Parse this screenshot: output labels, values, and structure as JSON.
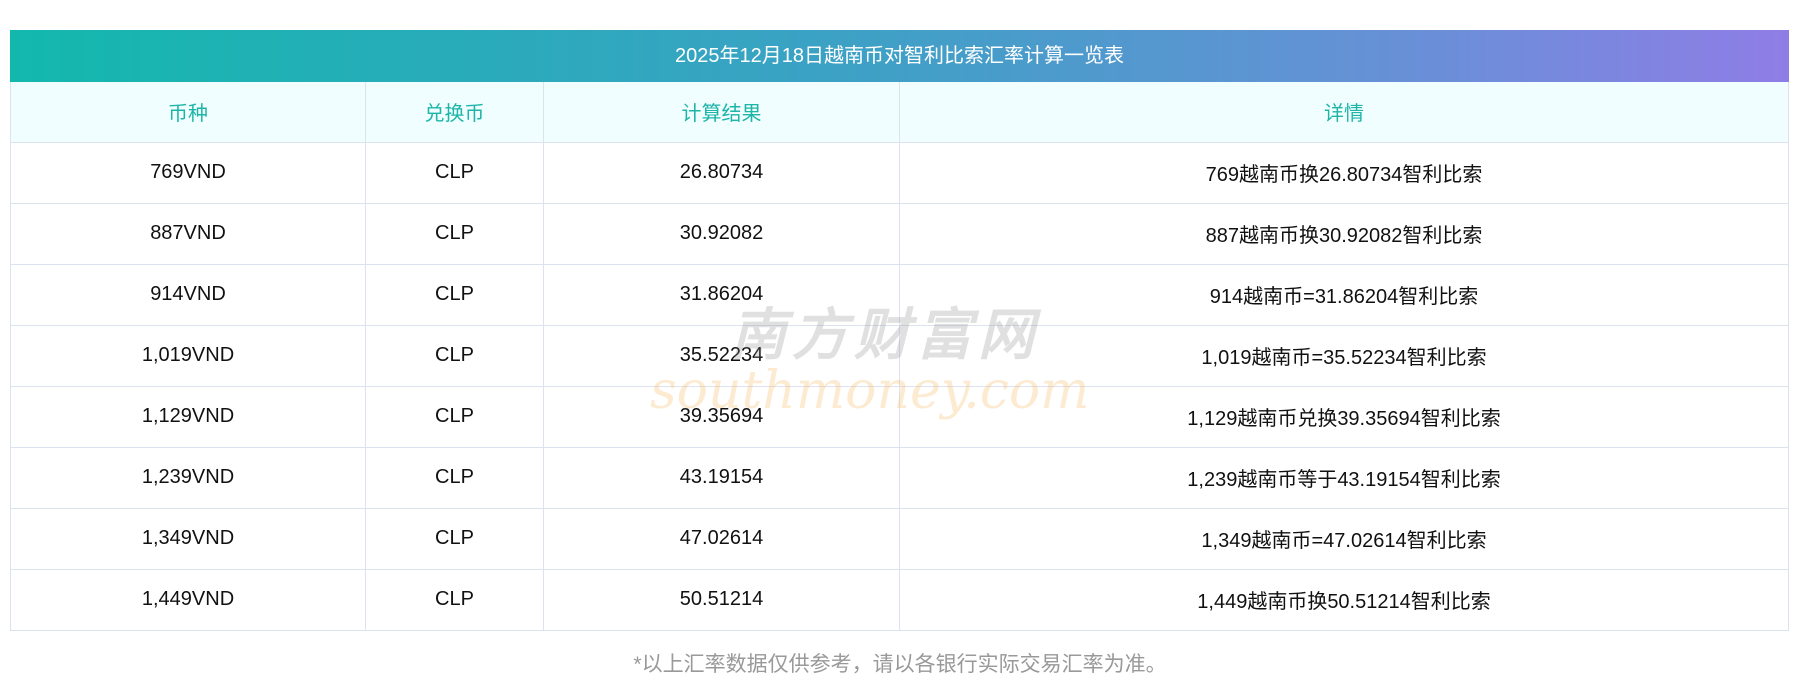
{
  "title": "2025年12月18日越南币对智利比索汇率计算一览表",
  "headers": [
    "币种",
    "兑换币",
    "计算结果",
    "详情"
  ],
  "rows": [
    [
      "769VND",
      "CLP",
      "26.80734",
      "769越南币换26.80734智利比索"
    ],
    [
      "887VND",
      "CLP",
      "30.92082",
      "887越南币换30.92082智利比索"
    ],
    [
      "914VND",
      "CLP",
      "31.86204",
      "914越南币=31.86204智利比索"
    ],
    [
      "1,019VND",
      "CLP",
      "35.52234",
      "1,019越南币=35.52234智利比索"
    ],
    [
      "1,129VND",
      "CLP",
      "39.35694",
      "1,129越南币兑换39.35694智利比索"
    ],
    [
      "1,239VND",
      "CLP",
      "43.19154",
      "1,239越南币等于43.19154智利比索"
    ],
    [
      "1,349VND",
      "CLP",
      "47.02614",
      "1,349越南币=47.02614智利比索"
    ],
    [
      "1,449VND",
      "CLP",
      "50.51214",
      "1,449越南币换50.51214智利比索"
    ]
  ],
  "footnote": "*以上汇率数据仅供参考，请以各银行实际交易汇率为准。",
  "watermark": {
    "cn": "南方财富网",
    "en": "southmoney.com"
  }
}
